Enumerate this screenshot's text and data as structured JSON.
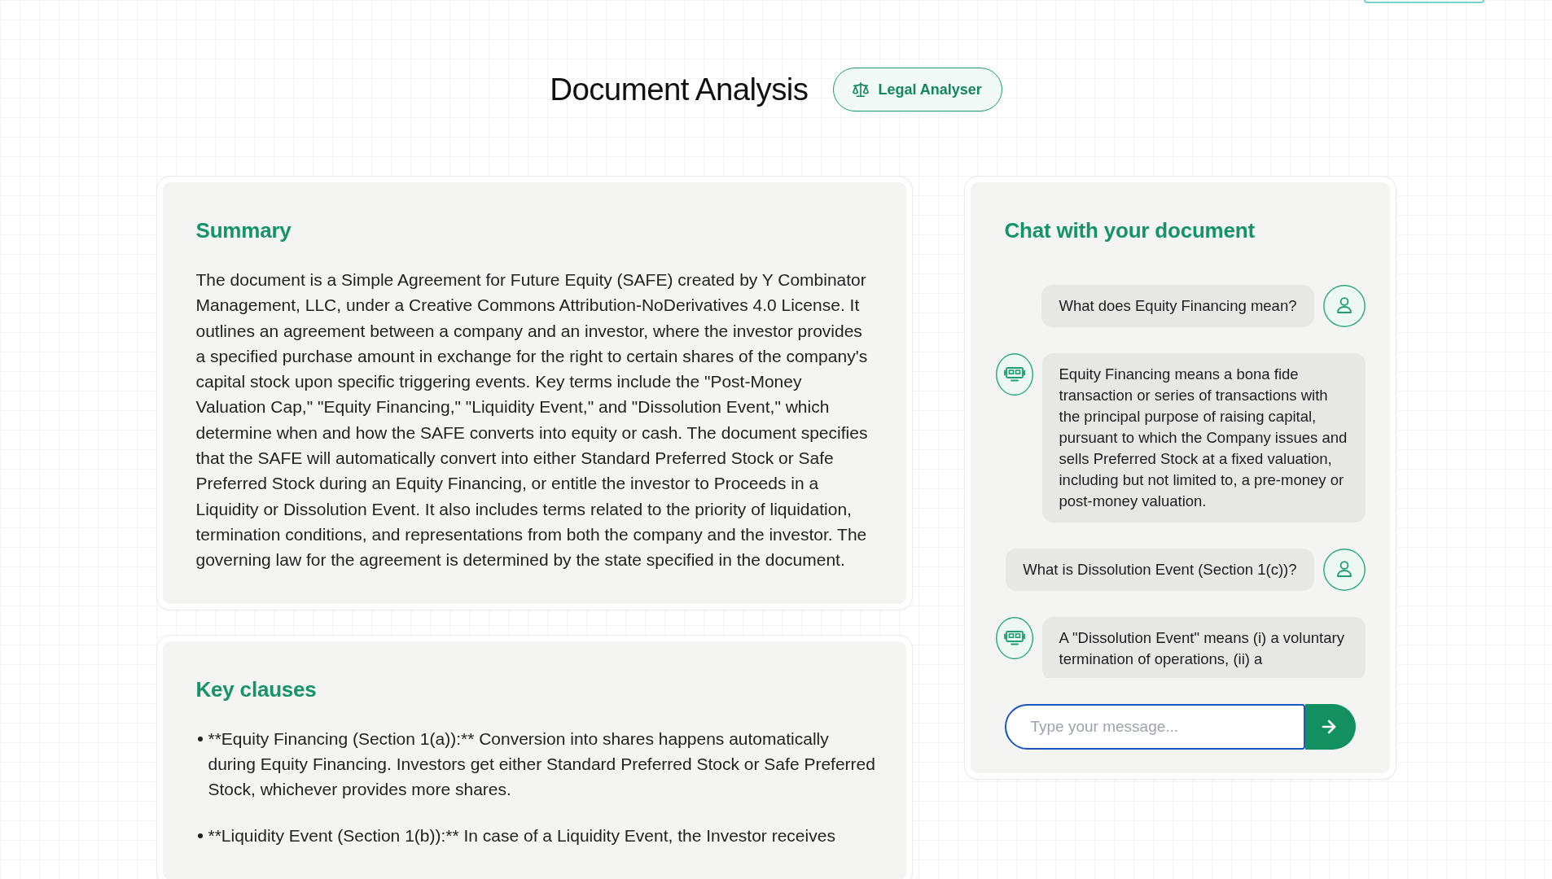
{
  "header": {
    "title": "Document Analysis",
    "badge": "Legal Analyser"
  },
  "summary": {
    "heading": "Summary",
    "text": "The document is a Simple Agreement for Future Equity (SAFE) created by Y Combinator Management, LLC, under a Creative Commons Attribution-NoDerivatives 4.0 License. It outlines an agreement between a company and an investor, where the investor provides a specified purchase amount in exchange for the right to certain shares of the company's capital stock upon specific triggering events. Key terms include the \"Post-Money Valuation Cap,\" \"Equity Financing,\" \"Liquidity Event,\" and \"Dissolution Event,\" which determine when and how the SAFE converts into equity or cash. The document specifies that the SAFE will automatically convert into either Standard Preferred Stock or Safe Preferred Stock during an Equity Financing, or entitle the investor to Proceeds in a Liquidity or Dissolution Event. It also includes terms related to the priority of liquidation, termination conditions, and representations from both the company and the investor. The governing law for the agreement is determined by the state specified in the document."
  },
  "key_clauses": {
    "heading": "Key clauses",
    "items": [
      "**Equity Financing (Section 1(a)):** Conversion into shares happens automatically during Equity Financing. Investors get either Standard Preferred Stock or Safe Preferred Stock, whichever provides more shares.",
      "**Liquidity Event (Section 1(b)):** In case of a Liquidity Event, the Investor receives"
    ]
  },
  "chat": {
    "title": "Chat with your document",
    "messages": [
      {
        "kind": "user",
        "text": "What does Equity Financing mean?"
      },
      {
        "kind": "bot",
        "text": "Equity Financing means a bona fide transaction or series of transactions with the principal purpose of raising capital, pursuant to which the Company issues and sells Preferred Stock at a fixed valuation, including but not limited to, a pre-money or post-money valuation."
      },
      {
        "kind": "user",
        "text": "What is Dissolution Event (Section 1(c))?"
      },
      {
        "kind": "bot",
        "text": "A \"Dissolution Event\" means (i) a voluntary termination of operations, (ii) a"
      }
    ],
    "input": {
      "placeholder": "Type your message...",
      "focused": true
    }
  }
}
